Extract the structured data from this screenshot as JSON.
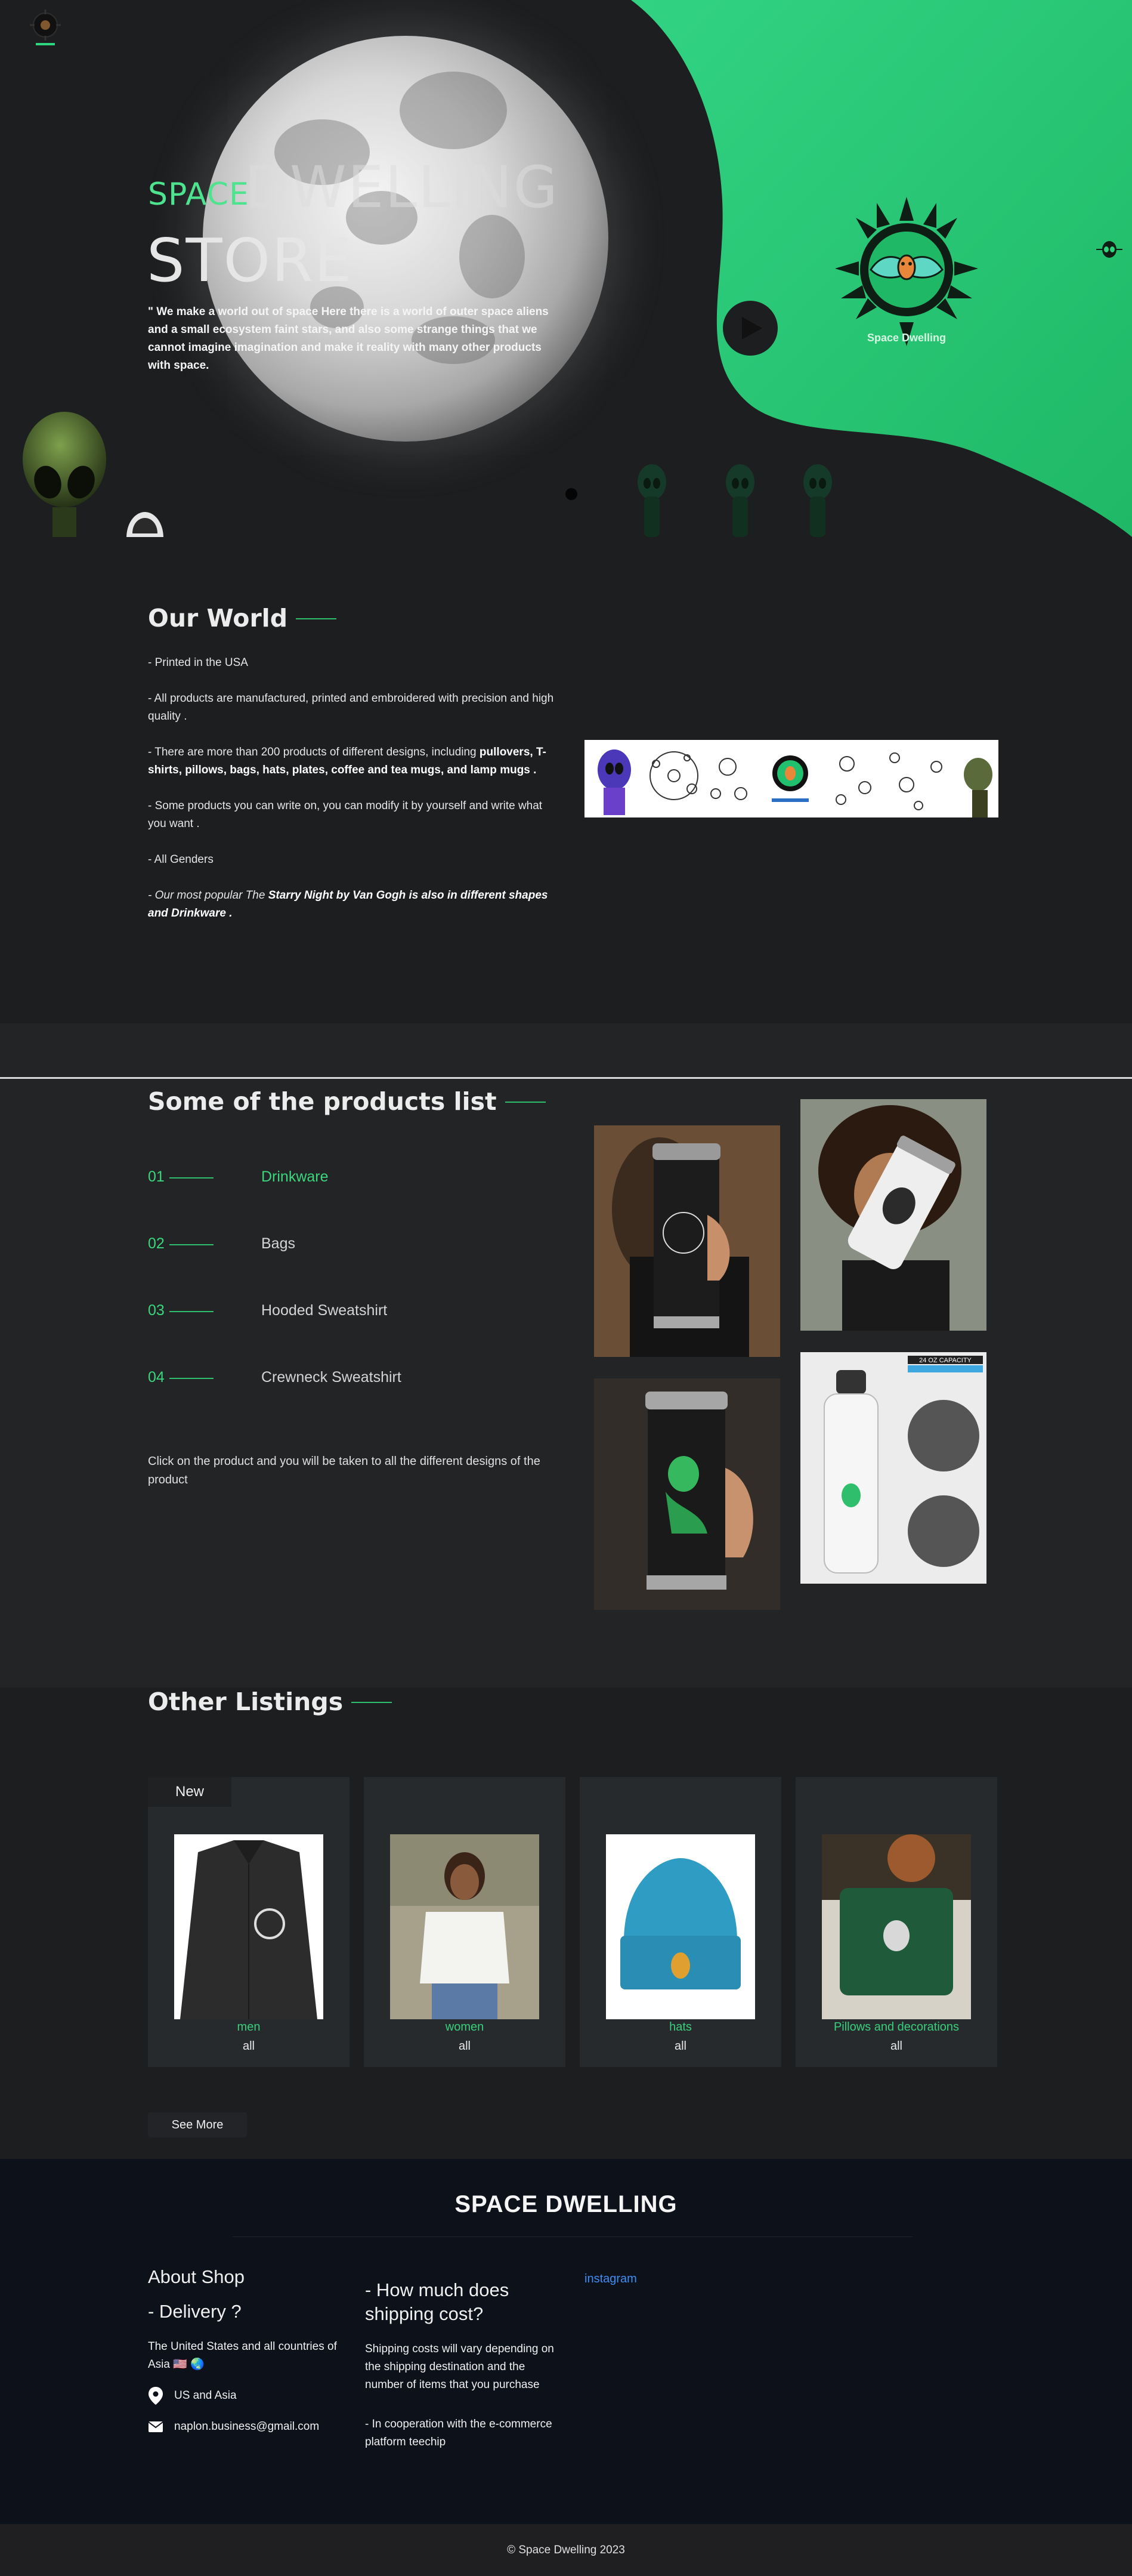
{
  "hero": {
    "logo_alt": "space-dwelling-logo",
    "title_accent": "SPACE",
    "title_ghost": "DWELLING",
    "title_main": "STORE",
    "tagline": "\" We make a world out of space Here there is a world of outer space aliens and a small ecosystem faint stars, and also some strange things that we cannot imagine imagination and make it reality with many other products with space.",
    "emblem_label": "Space Dwelling",
    "colors": {
      "green": "#27c871",
      "green_light": "#2fd680",
      "bg": "#1c1e20",
      "accent": "#4ee38e"
    }
  },
  "world": {
    "title": "Our World",
    "items": [
      {
        "text": "- Printed in the USA"
      },
      {
        "text": "- All products are manufactured, printed and embroidered with precision and high quality ."
      },
      {
        "pre": "- There are more than 200 products of different designs, including ",
        "bold": "pullovers, T-shirts, pillows, bags, hats, plates, coffee and tea mugs, and lamp mugs ."
      },
      {
        "text": "- Some products you can write on, you can modify it by yourself and write what you want ."
      },
      {
        "text": "- All Genders"
      },
      {
        "pre": "- Our most popular The ",
        "bold": "Starry Night by Van Gogh is also in different shapes and Drinkware ."
      }
    ],
    "banner_label": "Space Dwelling"
  },
  "products": {
    "title": "Some of the products list",
    "items": [
      {
        "num": "01",
        "label": "Drinkware",
        "active": true
      },
      {
        "num": "02",
        "label": "Bags",
        "active": false
      },
      {
        "num": "03",
        "label": "Hooded Sweatshirt",
        "active": false
      },
      {
        "num": "04",
        "label": "Crewneck Sweatshirt",
        "active": false
      }
    ],
    "note": "Click on the product and you will be taken to all the different designs of the product",
    "bottle_label": "24 OZ CAPACITY"
  },
  "listings": {
    "title": "Other Listings",
    "badge": "New",
    "cards": [
      {
        "category": "men",
        "sub": "all"
      },
      {
        "category": "women",
        "sub": "all"
      },
      {
        "category": "hats",
        "sub": "all"
      },
      {
        "category": "Pillows and decorations",
        "sub": "all"
      }
    ],
    "see_more": "See More"
  },
  "footer": {
    "brand": "SPACE DWELLING",
    "about_title": "About Shop",
    "delivery_title": "- Delivery ?",
    "delivery_text": "The United States and all countries of Asia 🇺🇸 🌏",
    "location": "US and Asia",
    "email": "naplon.business@gmail.com",
    "shipping_title": "- How much does shipping cost?",
    "shipping_text": "Shipping costs will vary depending on the shipping destination and the number of items that you purchase",
    "partner_text": "- In cooperation with the e-commerce platform teechip",
    "instagram": "instagram",
    "copyright": "© Space Dwelling 2023"
  }
}
